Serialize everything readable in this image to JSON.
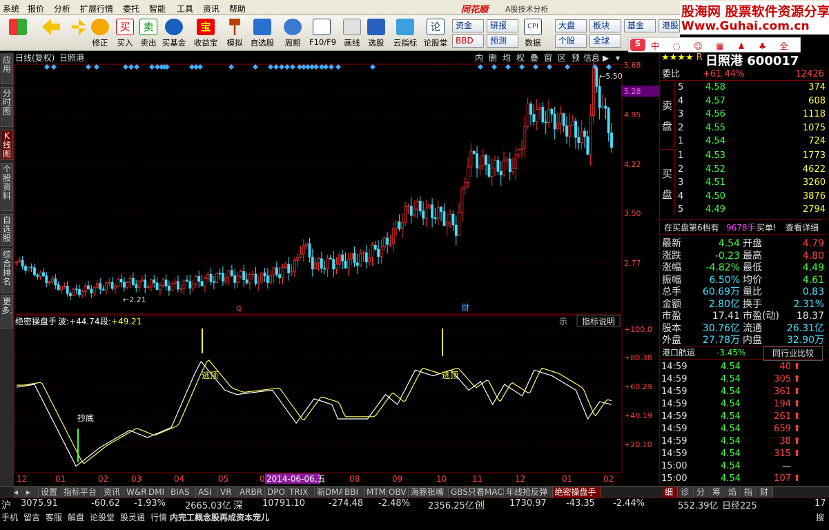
{
  "menu": [
    "系统",
    "报价",
    "分析",
    "扩展行情",
    "委托",
    "智能",
    "工具",
    "资讯",
    "帮助"
  ],
  "app": {
    "logo": "同花顺",
    "subtitle": "A股技术分析"
  },
  "watermark": {
    "line1": "股海网 股票软件资源分享",
    "line2": "Www.Guhai.com.cn"
  },
  "toolbar": [
    "",
    "",
    "修正",
    "买入",
    "卖出",
    "买基金",
    "收益宝",
    "模拟",
    "自选股",
    "周期",
    "F10/F9",
    "画线",
    "选股",
    "云指标",
    "论股堂",
    "数据"
  ],
  "toolbar_small": [
    "资金",
    "研报",
    "大盘",
    "板块",
    "基金",
    "港股",
    "BBD",
    "预测",
    "个股",
    "全球"
  ],
  "toolbar_cpi": "CPI",
  "left_tabs": [
    "应用",
    "分时图",
    "K线图",
    "个股资料",
    "自选股",
    "综合排名",
    "更多."
  ],
  "chart_header": {
    "period": "日线(复权)",
    "name": "日照港"
  },
  "chart_tools": [
    "内",
    "删",
    "均",
    "权",
    "叠",
    "窗",
    "区",
    "预",
    "信息"
  ],
  "price_axis": [
    "5.68",
    "5.28",
    "4.95",
    "4.22",
    "3.50",
    "2.77"
  ],
  "price_labels": {
    "high": "5.50",
    "low": "2.21"
  },
  "event_marks": [
    "q",
    "财"
  ],
  "indicator": {
    "name": "绝密操盘手",
    "wave_label": "波:",
    "wave": "+44.74",
    "seg_label": "段:",
    "seg": "+49.21",
    "help": "指标说明",
    "hint": "示"
  },
  "ind_axis": [
    "+100.0",
    "+80.38",
    "+60.29",
    "+40.19",
    "+20.10"
  ],
  "ind_labels": [
    "抄底",
    "逃顶",
    "逃顶"
  ],
  "x_axis": [
    "12",
    "01",
    "02",
    "03",
    "04",
    "05",
    "06",
    "07",
    "08",
    "09",
    "10",
    "11",
    "12",
    "01",
    "02"
  ],
  "date_hl": "2014-06-06,五",
  "stock": {
    "name": "日照港",
    "code": "600017",
    "star": "★★★★",
    "r": "R"
  },
  "weibi": {
    "label": "委比",
    "value": "+61.44%",
    "diff": "12426"
  },
  "sell": [
    {
      "n": "5",
      "p": "4.58",
      "v": "374"
    },
    {
      "n": "4",
      "p": "4.57",
      "v": "608"
    },
    {
      "n": "3",
      "p": "4.56",
      "v": "1118"
    },
    {
      "n": "2",
      "p": "4.55",
      "v": "1075"
    },
    {
      "n": "1",
      "p": "4.54",
      "v": "724"
    }
  ],
  "buy": [
    {
      "n": "1",
      "p": "4.53",
      "v": "1773"
    },
    {
      "n": "2",
      "p": "4.52",
      "v": "4622"
    },
    {
      "n": "3",
      "p": "4.51",
      "v": "3260"
    },
    {
      "n": "4",
      "p": "4.50",
      "v": "3876"
    },
    {
      "n": "5",
      "p": "4.49",
      "v": "2794"
    }
  ],
  "sell_side": "卖盘",
  "buy_side": "买盘",
  "notice": {
    "a": "在买盘第6档有",
    "b": "9678手",
    "c": "买单!",
    "d": "查看详细"
  },
  "stats": [
    {
      "k1": "最新",
      "v1": "4.54",
      "k2": "开盘",
      "v2": "4.79"
    },
    {
      "k1": "涨跌",
      "v1": "-0.23",
      "k2": "最高",
      "v2": "4.80"
    },
    {
      "k1": "涨幅",
      "v1": "-4.82%",
      "k2": "最低",
      "v2": "4.49"
    },
    {
      "k1": "振幅",
      "v1": "6.50%",
      "k2": "均价",
      "v2": "4.61"
    },
    {
      "k1": "总手",
      "v1": "60.69万",
      "k2": "量比",
      "v2": "0.83"
    },
    {
      "k1": "金额",
      "v1": "2.80亿",
      "k2": "换手",
      "v2": "2.31%"
    },
    {
      "k1": "市盈",
      "v1": "17.41",
      "k2": "市盈(动)",
      "v2": "18.37"
    },
    {
      "k1": "股本",
      "v1": "30.76亿",
      "k2": "流通",
      "v2": "26.31亿"
    },
    {
      "k1": "外盘",
      "v1": "27.78万",
      "k2": "内盘",
      "v2": "32.90万"
    }
  ],
  "industry": {
    "name": "港口航运",
    "chg": "-3.45%",
    "btn": "同行业比较"
  },
  "ticks": [
    {
      "t": "14:59",
      "p": "4.54",
      "v": "40",
      "d": "up"
    },
    {
      "t": "14:59",
      "p": "4.54",
      "v": "305",
      "d": "up"
    },
    {
      "t": "14:59",
      "p": "4.54",
      "v": "361",
      "d": "up"
    },
    {
      "t": "14:59",
      "p": "4.54",
      "v": "194",
      "d": "up"
    },
    {
      "t": "14:59",
      "p": "4.54",
      "v": "261",
      "d": "up"
    },
    {
      "t": "14:59",
      "p": "4.54",
      "v": "659",
      "d": "up"
    },
    {
      "t": "14:59",
      "p": "4.54",
      "v": "38",
      "d": "up"
    },
    {
      "t": "14:59",
      "p": "4.54",
      "v": "315",
      "d": "up"
    },
    {
      "t": "15:00",
      "p": "4.54",
      "v": "—",
      "d": ""
    },
    {
      "t": "15:00",
      "p": "4.54",
      "v": "107",
      "d": "up"
    }
  ],
  "bottom_tabs": [
    "设置",
    "指标平台",
    "资讯",
    "W&R",
    "DMI",
    "BIAS",
    "ASI",
    "VR",
    "ARBR",
    "DPO",
    "TRIX",
    "新DMA",
    "BBI",
    "MTM",
    "OBV",
    "海豚张嘴",
    "GBS只看MACD",
    "年线抢反弹",
    "绝密操盘手"
  ],
  "right_tabs": [
    "细",
    "诊",
    "分",
    "筹",
    "焰",
    "指",
    "财"
  ],
  "index_bar": {
    "sh": "沪",
    "sh_v": "3075.91",
    "sh_c": "-60.62",
    "sh_p": "-1.93%",
    "sh_a": "2665.03亿",
    "sz": "深",
    "sz_v": "10791.10",
    "sz_c": "-274.48",
    "sz_p": "-2.48%",
    "sz_a": "2356.25亿",
    "cy": "创",
    "cy_v": "1730.97",
    "cy_c": "-43.35",
    "cy_p": "-2.44%",
    "cy_a": "552.39亿",
    "nk": "日经225",
    "last": "17"
  },
  "bottom_bar": [
    "手机",
    "留言",
    "客服",
    "解盘",
    "论股堂",
    "股灵通",
    "行情"
  ],
  "news": "内完工概念股再成资本宠儿",
  "search": "搜"
}
